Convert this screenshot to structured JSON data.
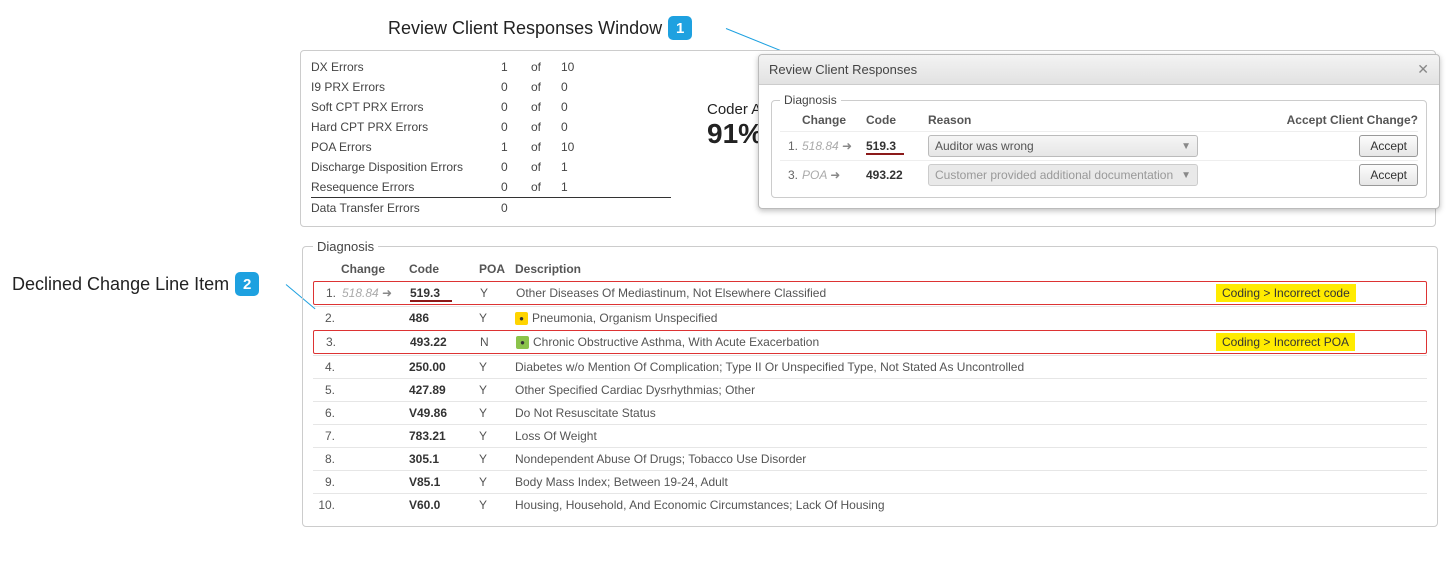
{
  "annotations": {
    "callout1": {
      "label": "Review Client Responses Window",
      "badge": "1"
    },
    "callout2": {
      "label": "Declined Change Line Item",
      "badge": "2"
    }
  },
  "errors": {
    "rows": [
      {
        "label": "DX Errors",
        "count": "1",
        "of": "of",
        "total": "10"
      },
      {
        "label": "I9 PRX Errors",
        "count": "0",
        "of": "of",
        "total": "0"
      },
      {
        "label": "Soft CPT PRX Errors",
        "count": "0",
        "of": "of",
        "total": "0"
      },
      {
        "label": "Hard CPT PRX Errors",
        "count": "0",
        "of": "of",
        "total": "0"
      },
      {
        "label": "POA Errors",
        "count": "1",
        "of": "of",
        "total": "10"
      },
      {
        "label": "Discharge Disposition Errors",
        "count": "0",
        "of": "of",
        "total": "1"
      },
      {
        "label": "Resequence Errors",
        "count": "0",
        "of": "of",
        "total": "1"
      },
      {
        "label": "Data Transfer Errors",
        "count": "0",
        "of": "",
        "total": ""
      }
    ]
  },
  "accuracy": {
    "label": "Coder Accu",
    "value": "91%"
  },
  "diagnosis": {
    "legend": "Diagnosis",
    "headers": {
      "change": "Change",
      "code": "Code",
      "poa": "POA",
      "desc": "Description"
    },
    "rows": [
      {
        "idx": "1.",
        "change": "518.84",
        "code": "519.3",
        "code_underlined": true,
        "poa": "Y",
        "desc": "Other Diseases Of Mediastinum, Not Elsewhere Classified",
        "tag": "Coding > Incorrect code",
        "declined": true
      },
      {
        "idx": "2.",
        "change": "",
        "code": "486",
        "poa": "Y",
        "flag": "yellow",
        "desc": "Pneumonia, Organism Unspecified"
      },
      {
        "idx": "3.",
        "change": "",
        "code": "493.22",
        "poa": "N",
        "flag": "green",
        "desc": "Chronic Obstructive Asthma, With Acute Exacerbation",
        "tag": "Coding > Incorrect POA",
        "declined": true
      },
      {
        "idx": "4.",
        "change": "",
        "code": "250.00",
        "poa": "Y",
        "desc": "Diabetes w/o Mention Of Complication; Type II Or Unspecified Type, Not Stated As Uncontrolled"
      },
      {
        "idx": "5.",
        "change": "",
        "code": "427.89",
        "poa": "Y",
        "desc": "Other Specified Cardiac Dysrhythmias; Other"
      },
      {
        "idx": "6.",
        "change": "",
        "code": "V49.86",
        "poa": "Y",
        "desc": "Do Not Resuscitate Status"
      },
      {
        "idx": "7.",
        "change": "",
        "code": "783.21",
        "poa": "Y",
        "desc": "Loss Of Weight"
      },
      {
        "idx": "8.",
        "change": "",
        "code": "305.1",
        "poa": "Y",
        "desc": "Nondependent Abuse Of Drugs; Tobacco Use Disorder"
      },
      {
        "idx": "9.",
        "change": "",
        "code": "V85.1",
        "poa": "Y",
        "desc": "Body Mass Index; Between 19-24, Adult"
      },
      {
        "idx": "10.",
        "change": "",
        "code": "V60.0",
        "poa": "Y",
        "desc": "Housing, Household, And Economic Circumstances; Lack Of Housing"
      }
    ]
  },
  "popup": {
    "title": "Review Client Responses",
    "legend": "Diagnosis",
    "headers": {
      "change": "Change",
      "code": "Code",
      "reason": "Reason",
      "accept": "Accept Client Change?"
    },
    "rows": [
      {
        "idx": "1.",
        "change": "518.84",
        "code": "519.3",
        "code_underlined": true,
        "reason": "Auditor was wrong",
        "accept": "Accept",
        "disabled": false
      },
      {
        "idx": "3.",
        "change": "POA",
        "code": "493.22",
        "reason": "Customer provided additional documentation",
        "accept": "Accept",
        "disabled": true
      }
    ]
  }
}
